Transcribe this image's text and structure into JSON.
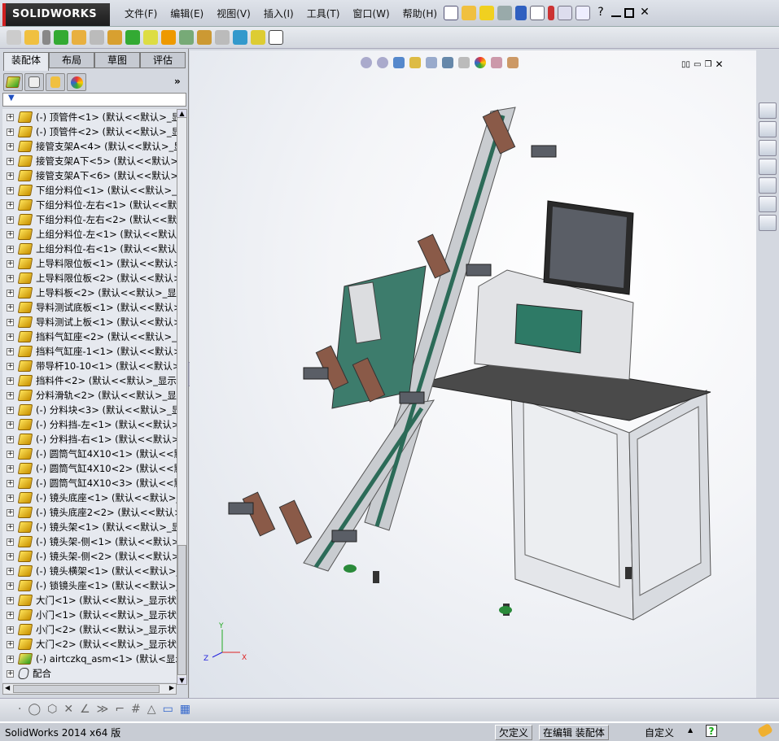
{
  "app": {
    "brand": "SOLIDWORKS"
  },
  "menu": [
    "文件(F)",
    "编辑(E)",
    "视图(V)",
    "插入(I)",
    "工具(T)",
    "窗口(W)",
    "帮助(H)"
  ],
  "left_panel": {
    "tabs": [
      "装配体",
      "布局",
      "草图",
      "评估"
    ],
    "active_tab": "装配体",
    "more": "»",
    "tree": [
      "(-) 顶管件<1> (默认<<默认>_显示",
      "(-) 顶管件<2> (默认<<默认>_显示",
      "接管支架A<4> (默认<<默认>_显",
      "接管支架A下<5> (默认<<默认>_",
      "接管支架A下<6> (默认<<默认>_",
      "下组分料位<1> (默认<<默认>_显",
      "下组分料位-左右<1> (默认<<默认",
      "下组分料位-左右<2> (默认<<默认",
      "上组分料位-左<1> (默认<<默认>",
      "上组分料位-右<1> (默认<<默认>",
      "上导料限位板<1> (默认<<默认>",
      "上导料限位板<2> (默认<<默认>",
      "上导料板<2> (默认<<默认>_显示",
      "导料测试底板<1> (默认<<默认>",
      "导料测试上板<1> (默认<<默认>",
      "挡料气缸座<2> (默认<<默认>_显",
      "挡料气缸座-1<1> (默认<<默认>_",
      "带导杆10-10<1> (默认<<默认>_",
      "挡料件<2> (默认<<默认>_显示状",
      "分料滑轨<2> (默认<<默认>_显示",
      "(-) 分料块<3> (默认<<默认>_显示",
      "(-) 分料挡-左<1> (默认<<默认>_",
      "(-) 分料挡-右<1> (默认<<默认>_",
      "(-) 圆筒气缸4X10<1> (默认<<默认",
      "(-) 圆筒气缸4X10<2> (默认<<默认",
      "(-) 圆筒气缸4X10<3> (默认<<默认",
      "(-) 镜头底座<1> (默认<<默认>_显",
      "(-) 镜头底座2<2> (默认<<默认>_",
      "(-) 镜头架<1> (默认<<默认>_显示",
      "(-) 镜头架-侧<1> (默认<<默认>_",
      "(-) 镜头架-侧<2> (默认<<默认>_",
      "(-) 镜头横架<1> (默认<<默认>_显",
      "(-) 锁镜头座<1> (默认<<默认>_显",
      "大门<1> (默认<<默认>_显示状态",
      "小门<1> (默认<<默认>_显示状态",
      "小门<2> (默认<<默认>_显示状态",
      "大门<2> (默认<<默认>_显示状态",
      "(-) airtczkq_asm<1> (默认<显示状",
      "配合"
    ]
  },
  "triad": {
    "x": "X",
    "y": "Y",
    "z": "Z"
  },
  "status": {
    "product": "SolidWorks 2014 x64 版",
    "definition": "欠定义",
    "editing": "在编辑 装配体",
    "units": "自定义",
    "help": "?"
  }
}
